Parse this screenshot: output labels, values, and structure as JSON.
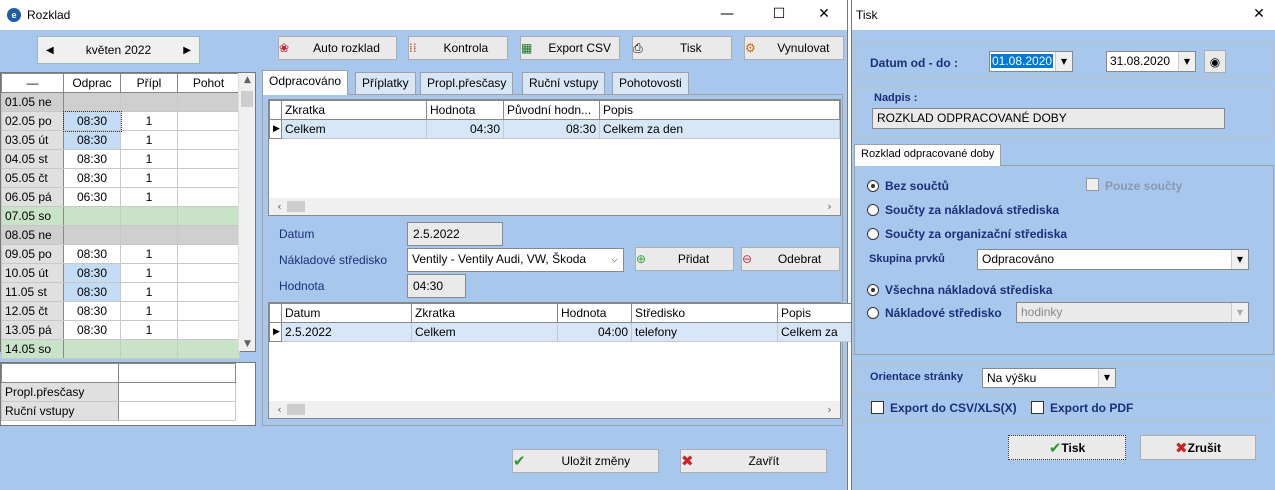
{
  "main": {
    "title": "Rozklad",
    "month": "květen 2022",
    "toolbar": {
      "auto": "Auto rozklad",
      "kontrola": "Kontrola",
      "export": "Export CSV",
      "tisk": "Tisk",
      "vynulovat": "Vynulovat"
    },
    "left_grid": {
      "headers": [
        "—",
        "Odprac",
        "Přípl",
        "Pohot"
      ],
      "rows": [
        {
          "day": "01.05 ne",
          "odprac": "",
          "pripl": "",
          "type": "mon"
        },
        {
          "day": "02.05 po",
          "odprac": "08:30",
          "pripl": "1",
          "type": ""
        },
        {
          "day": "03.05 út",
          "odprac": "08:30",
          "pripl": "1",
          "type": ""
        },
        {
          "day": "04.05 st",
          "odprac": "08:30",
          "pripl": "1",
          "type": ""
        },
        {
          "day": "05.05 čt",
          "odprac": "08:30",
          "pripl": "1",
          "type": ""
        },
        {
          "day": "06.05 pá",
          "odprac": "06:30",
          "pripl": "1",
          "type": ""
        },
        {
          "day": "07.05 so",
          "odprac": "",
          "pripl": "",
          "type": "sun"
        },
        {
          "day": "08.05 ne",
          "odprac": "",
          "pripl": "",
          "type": "mon"
        },
        {
          "day": "09.05 po",
          "odprac": "08:30",
          "pripl": "1",
          "type": ""
        },
        {
          "day": "10.05 út",
          "odprac": "08:30",
          "pripl": "1",
          "type": ""
        },
        {
          "day": "11.05 st",
          "odprac": "08:30",
          "pripl": "1",
          "type": ""
        },
        {
          "day": "12.05 čt",
          "odprac": "08:30",
          "pripl": "1",
          "type": ""
        },
        {
          "day": "13.05 pá",
          "odprac": "08:30",
          "pripl": "1",
          "type": ""
        },
        {
          "day": "14.05 so",
          "odprac": "",
          "pripl": "",
          "type": "sun"
        }
      ]
    },
    "sum_rows": [
      "Propl.přesčasy",
      "Ruční vstupy"
    ],
    "tabs": [
      "Odpracováno",
      "Příplatky",
      "Propl.přesčasy",
      "Ruční vstupy",
      "Pohotovosti"
    ],
    "grid1": {
      "headers": [
        "Zkratka",
        "Hodnota",
        "Původní hodn...",
        "Popis"
      ],
      "row": [
        "Celkem",
        "04:30",
        "08:30",
        "Celkem za den"
      ]
    },
    "form": {
      "datum_label": "Datum",
      "datum": "2.5.2022",
      "stredisko_label": "Nákladové středisko",
      "stredisko": "Ventily - Ventily Audi, VW, Škoda",
      "hodnota_label": "Hodnota",
      "hodnota": "04:30",
      "pridat": "Přidat",
      "odebrat": "Odebrat"
    },
    "grid2": {
      "headers": [
        "Datum",
        "Zkratka",
        "Hodnota",
        "Středisko",
        "Popis"
      ],
      "row": [
        "2.5.2022",
        "Celkem",
        "04:00",
        "telefony",
        "Celkem za"
      ]
    },
    "save": "Uložit změny",
    "close": "Zavřít"
  },
  "dialog": {
    "title": "Tisk",
    "datum_label": "Datum od - do :",
    "date_from": "01.08.2020",
    "date_to": "31.08.2020",
    "nadpis_label": "Nadpis :",
    "nadpis": "ROZKLAD ODPRACOVANÉ DOBY",
    "tab": "Rozklad odpracované doby",
    "bez": "Bez součtů",
    "pouze": "Pouze součty",
    "soucty_nakl": "Součty za nákladová střediska",
    "soucty_org": "Součty za organizační střediska",
    "skupina_label": "Skupina prvků",
    "skupina": "Odpracováno",
    "vsechna": "Všechna nákladová střediska",
    "nakl_label": "Nákladové středisko",
    "nakl_value": "hodinky",
    "orientace_label": "Orientace stránky",
    "orientace": "Na výšku",
    "export_csv": "Export do CSV/XLS(X)",
    "export_pdf": "Export do PDF",
    "ok": "Tisk",
    "cancel": "Zrušit"
  }
}
